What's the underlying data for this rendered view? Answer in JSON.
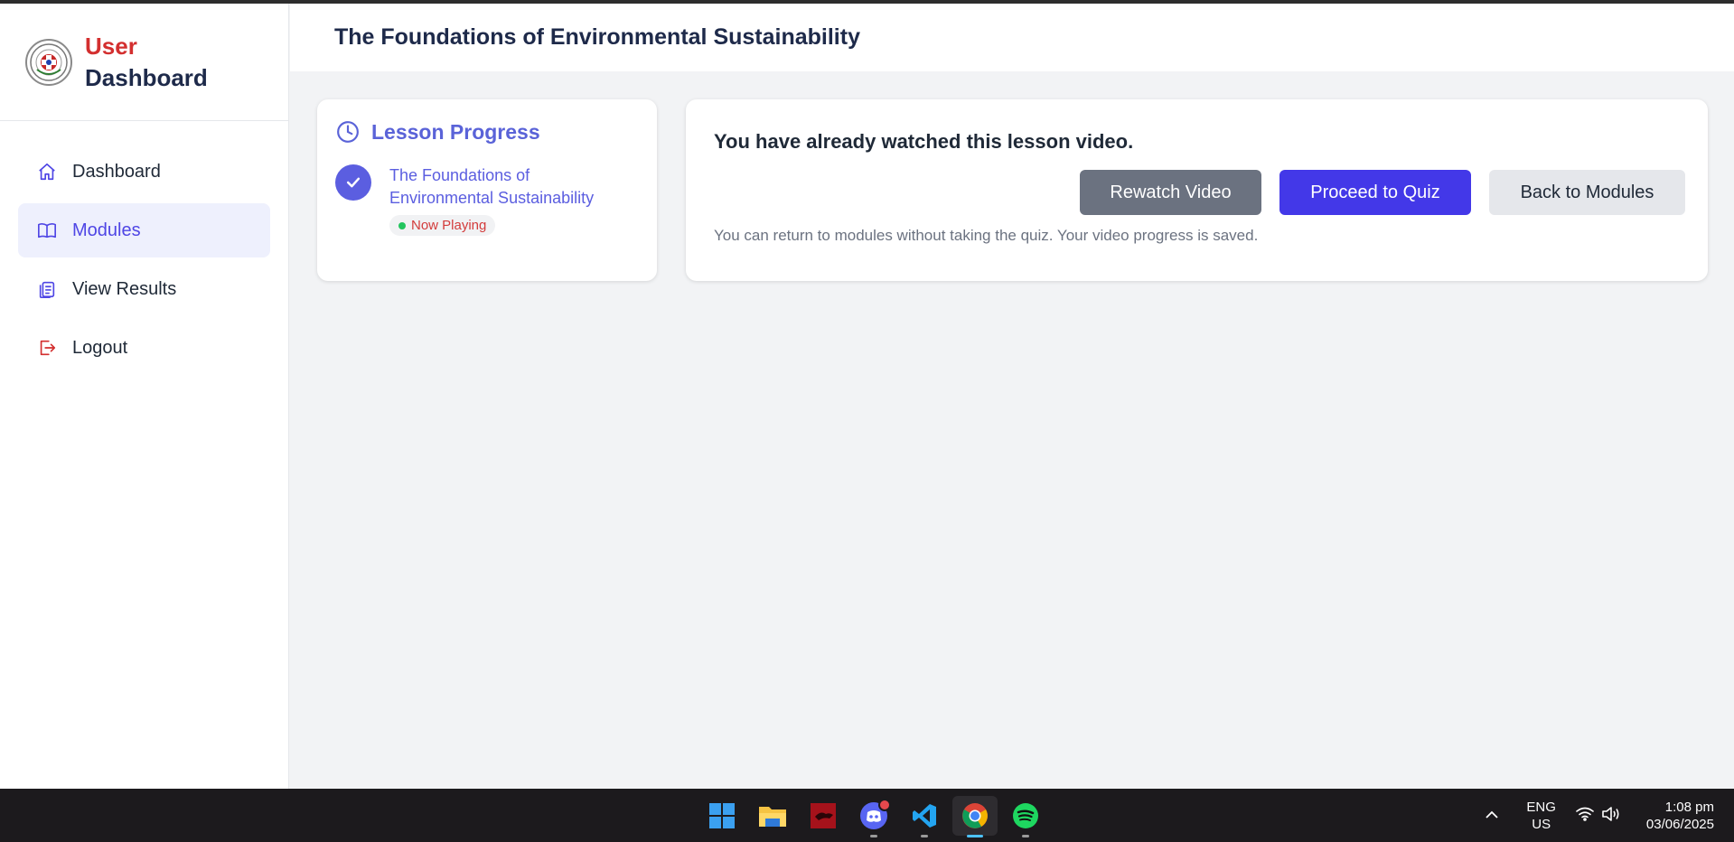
{
  "brand": {
    "line1": "User",
    "line2": "Dashboard",
    "logo_icon": "university-seal-logo"
  },
  "sidebar": {
    "items": [
      {
        "label": "Dashboard",
        "icon": "home-icon",
        "active": false
      },
      {
        "label": "Modules",
        "icon": "book-open-icon",
        "active": true
      },
      {
        "label": "View Results",
        "icon": "clipboard-icon",
        "active": false
      },
      {
        "label": "Logout",
        "icon": "logout-icon",
        "active": false
      }
    ]
  },
  "header": {
    "title": "The Foundations of Environmental Sustainability"
  },
  "lesson_progress": {
    "title": "Lesson Progress",
    "lesson_title": "The Foundations of Environmental Sustainability",
    "status_badge": "Now Playing"
  },
  "main": {
    "message": "You have already watched this lesson video.",
    "buttons": {
      "rewatch": "Rewatch Video",
      "quiz": "Proceed to Quiz",
      "back": "Back to Modules"
    },
    "hint": "You can return to modules without taking the quiz. Your video progress is saved."
  },
  "taskbar": {
    "apps": [
      "windows-start-icon",
      "file-explorer-icon",
      "red-app-icon",
      "discord-icon",
      "vscode-icon",
      "chrome-icon",
      "spotify-icon"
    ],
    "lang_line1": "ENG",
    "lang_line2": "US",
    "time": "1:08 pm",
    "date": "03/06/2025"
  },
  "colors": {
    "accent": "#4f46e5",
    "brand_red": "#d32f2f",
    "button_gray": "#6b7280",
    "button_blue": "#4338e8"
  }
}
